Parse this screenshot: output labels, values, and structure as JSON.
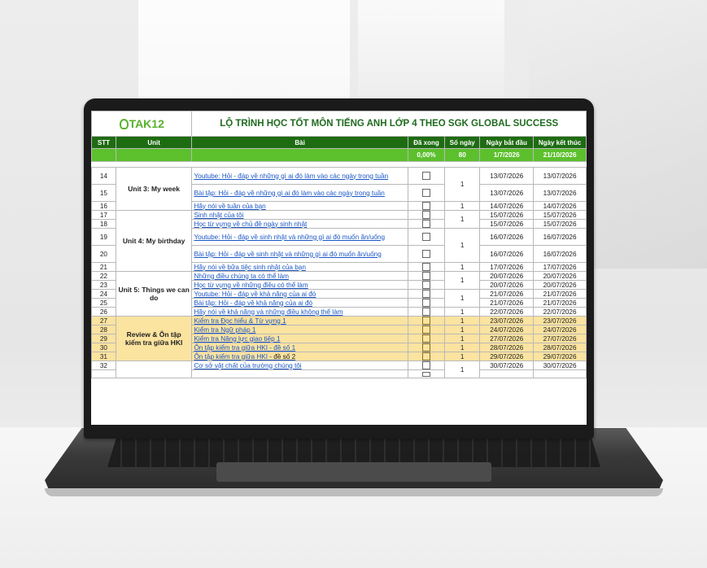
{
  "sheet": {
    "logo": "TAK12",
    "title": "LỘ TRÌNH HỌC TỐT MÔN TIẾNG ANH LỚP 4 THEO SGK GLOBAL SUCCESS",
    "headers": {
      "stt": "STT",
      "unit": "Unit",
      "bai": "Bài",
      "done": "Đã xong",
      "days": "Số ngày",
      "start": "Ngày bắt đầu",
      "end": "Ngày kết thúc"
    },
    "summary": {
      "done": "0,00%",
      "days": "80",
      "start": "1/7/2026",
      "end": "21/10/2026"
    },
    "units": {
      "u3": "Unit 3: My week",
      "u4": "Unit 4: My birthday",
      "u5": "Unit 5: Things we can do",
      "rv": "Review & Ôn tập kiểm tra giữa HKI"
    },
    "rows": [
      {
        "stt": "14",
        "bai": "Youtube: Hỏi - đáp về những gì ai đó làm vào các ngày trong tuần",
        "start": "13/07/2026",
        "end": "13/07/2026"
      },
      {
        "stt": "15",
        "bai": "Bài tập: Hỏi - đáp về những gì ai đó làm vào các ngày trong tuần",
        "start": "13/07/2026",
        "end": "13/07/2026"
      },
      {
        "stt": "16",
        "bai": "Hãy nói về tuần của bạn",
        "days": "1",
        "start": "14/07/2026",
        "end": "14/07/2026"
      },
      {
        "stt": "17",
        "bai": "Sinh nhật của tôi",
        "start": "15/07/2026",
        "end": "15/07/2026"
      },
      {
        "stt": "18",
        "bai": "Học từ vựng về chủ đề ngày sinh nhật",
        "start": "15/07/2026",
        "end": "15/07/2026"
      },
      {
        "stt": "19",
        "bai": "Youtube: Hỏi - đáp về sinh nhật và những gì ai đó muốn ăn/uống",
        "start": "16/07/2026",
        "end": "16/07/2026"
      },
      {
        "stt": "20",
        "bai": "Bài tập: Hỏi - đáp về sinh nhật và những gì ai đó muốn ăn/uống",
        "start": "16/07/2026",
        "end": "16/07/2026"
      },
      {
        "stt": "21",
        "bai": "Hãy nói về bữa tiệc sinh nhật của bạn",
        "days": "1",
        "start": "17/07/2026",
        "end": "17/07/2026"
      },
      {
        "stt": "22",
        "bai": "Những điều chúng ta có thể làm",
        "start": "20/07/2026",
        "end": "20/07/2026"
      },
      {
        "stt": "23",
        "bai": "Học từ vựng về những điều có thể làm",
        "start": "20/07/2026",
        "end": "20/07/2026"
      },
      {
        "stt": "24",
        "bai": "Youtube: Hỏi - đáp về khả năng của ai đó",
        "start": "21/07/2026",
        "end": "21/07/2026"
      },
      {
        "stt": "25",
        "bai": "Bài tập: Hỏi - đáp về khả năng của ai đó",
        "start": "21/07/2026",
        "end": "21/07/2026"
      },
      {
        "stt": "26",
        "bai": "Hãy nói về khả năng và những điều không thể làm",
        "days": "1",
        "start": "22/07/2026",
        "end": "22/07/2026"
      },
      {
        "stt": "27",
        "bai": "Kiểm tra Đọc hiểu & Từ vựng 1",
        "days": "1",
        "start": "23/07/2026",
        "end": "23/07/2026"
      },
      {
        "stt": "28",
        "bai": "Kiểm tra Ngữ pháp 1",
        "days": "1",
        "start": "24/07/2026",
        "end": "24/07/2026"
      },
      {
        "stt": "29",
        "bai": "Kiểm tra Năng lực giao tiếp 1",
        "days": "1",
        "start": "27/07/2026",
        "end": "27/07/2026"
      },
      {
        "stt": "30",
        "bai": "Ôn tập kiểm tra giữa HKI - đề số 1",
        "days": "1",
        "start": "28/07/2026",
        "end": "28/07/2026"
      },
      {
        "stt": "31",
        "bai": "Ôn tập kiểm tra giữa HKI",
        "bai_suffix": " - đề số 2",
        "days": "1",
        "start": "29/07/2026",
        "end": "29/07/2026"
      },
      {
        "stt": "32",
        "bai": "Cơ sở vật chất của trường chúng tôi",
        "start": "30/07/2026",
        "end": "30/07/2026"
      }
    ],
    "merged_days": {
      "g14_15": "1",
      "g17_18": "1",
      "g19_20": "1",
      "g22_23": "1",
      "g24_25": "1",
      "g32": "1"
    }
  },
  "colors": {
    "header_bg": "#1e6c12",
    "summary_bg": "#5cc02d",
    "review_bg": "#fbe3a0",
    "link": "#1a56c4",
    "title": "#1f6b1f"
  }
}
